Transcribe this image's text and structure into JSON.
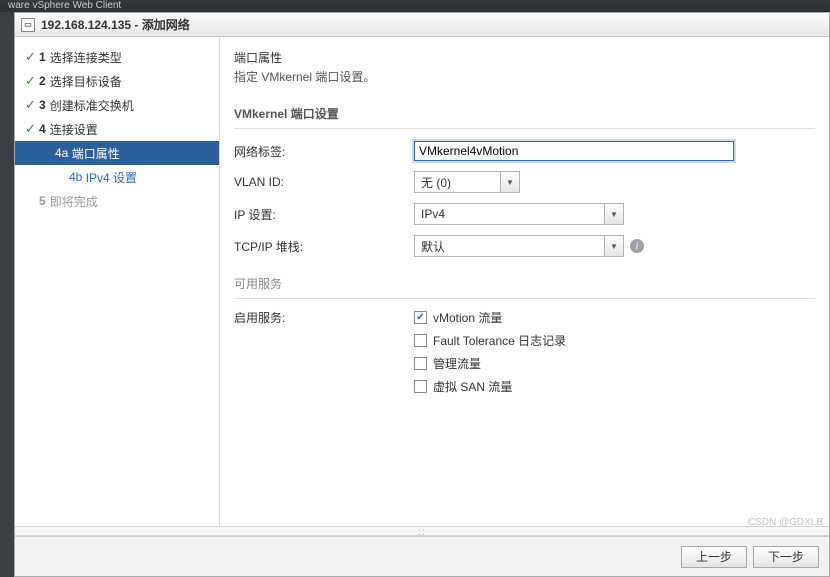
{
  "top_bar": "ware vSphere Web Client",
  "dialog": {
    "title_ip": "192.168.124.135",
    "title_action": "添加网络"
  },
  "steps": {
    "s1": "选择连接类型",
    "s2": "选择目标设备",
    "s3": "创建标准交换机",
    "s4": "连接设置",
    "s4a": "端口属性",
    "s4b": "IPv4 设置",
    "s5": "即将完成"
  },
  "header": {
    "title": "端口属性",
    "subtitle": "指定 VMkernel 端口设置。"
  },
  "section_port": "VMkernel 端口设置",
  "labels": {
    "net_label": "网络标签:",
    "vlan": "VLAN ID:",
    "ip": "IP 设置:",
    "tcpip": "TCP/IP 堆栈:",
    "enable_svc": "启用服务:"
  },
  "values": {
    "net_label": "VMkernel4vMotion",
    "vlan": "无 (0)",
    "ip": "IPv4",
    "tcpip": "默认"
  },
  "section_svc": "可用服务",
  "svc": {
    "vmotion": "vMotion 流量",
    "ft": "Fault Tolerance 日志记录",
    "mgmt": "管理流量",
    "vsan": "虚拟 SAN 流量"
  },
  "buttons": {
    "back": "上一步",
    "next": "下一步"
  },
  "watermark": "CSDN @GDXLB"
}
